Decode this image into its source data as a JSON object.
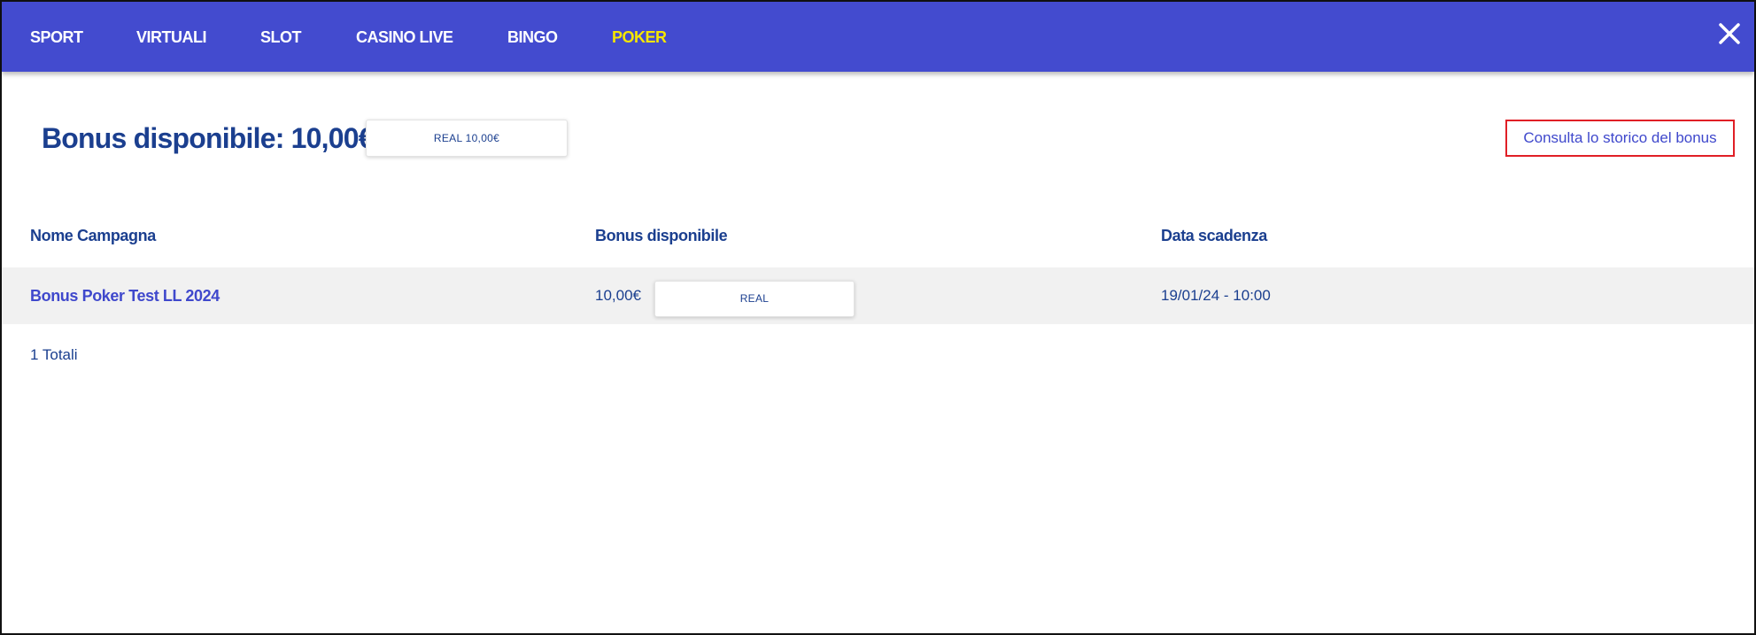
{
  "nav": {
    "items": [
      {
        "label": "SPORT",
        "active": false
      },
      {
        "label": "VIRTUALI",
        "active": false
      },
      {
        "label": "SLOT",
        "active": false
      },
      {
        "label": "CASINO LIVE",
        "active": false
      },
      {
        "label": "BINGO",
        "active": false
      },
      {
        "label": "POKER",
        "active": true
      }
    ],
    "close_icon": "close-icon"
  },
  "summary": {
    "title": "Bonus disponibile: 10,00€",
    "badge": "REAL 10,00€",
    "history_link": "Consulta lo storico del bonus"
  },
  "table": {
    "headers": [
      "Nome Campagna",
      "Bonus disponibile",
      "Data scadenza"
    ],
    "rows": [
      {
        "campaign": "Bonus Poker Test LL 2024",
        "amount": "10,00€",
        "type": "REAL",
        "expiry": "19/01/24 - 10:00"
      }
    ],
    "totals": "1 Totali"
  },
  "colors": {
    "topbar": "#434bcf",
    "active_nav": "#f5e600",
    "heading_blue": "#1b3f8f",
    "link_blue": "#3f48cc",
    "highlight_border": "#e01f26",
    "row_background": "#f1f1f1"
  }
}
